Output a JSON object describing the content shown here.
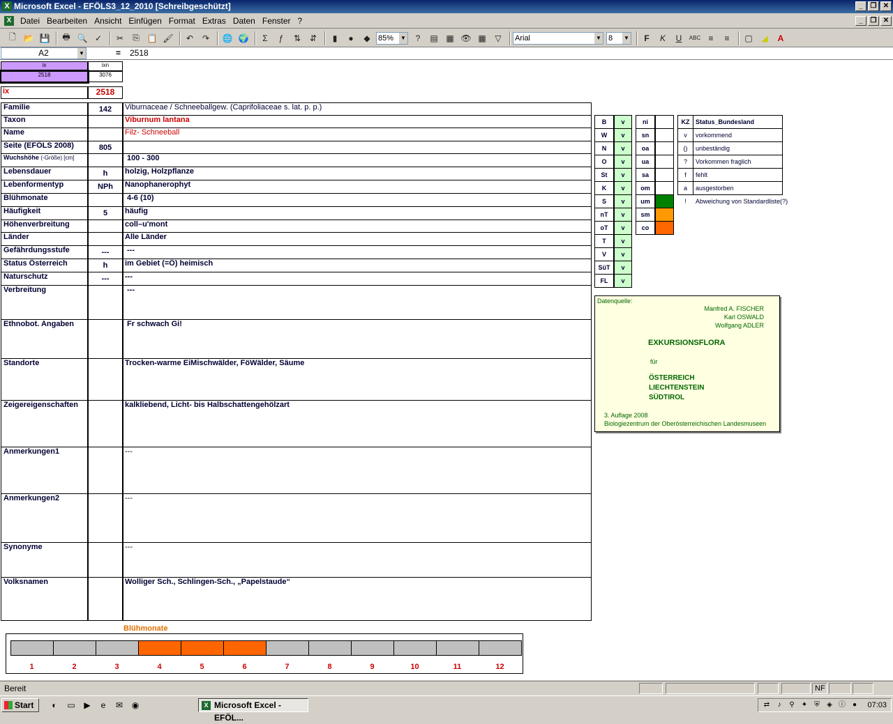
{
  "window": {
    "title": "Microsoft Excel - EFÖLS3_12_2010  [Schreibgeschützt]"
  },
  "menu": [
    "Datei",
    "Bearbeiten",
    "Ansicht",
    "Einfügen",
    "Format",
    "Extras",
    "Daten",
    "Fenster",
    "?"
  ],
  "toolbar": {
    "zoom": "85%",
    "font": "Arial",
    "size": "8"
  },
  "formula": {
    "cell": "A2",
    "fx": "=",
    "value": "2518"
  },
  "sheet": {
    "top_labels": {
      "ix": "ix",
      "ixn": "ixn"
    },
    "top_values": {
      "ix": "2518",
      "ixn": "3076"
    },
    "ix_label": "ix",
    "ix_value": "2518",
    "rows": [
      {
        "label": "Familie",
        "mid": "142",
        "value": "Viburnaceae  /  Schneeballgew. (Caprifoliaceae s. lat. p. p.)"
      },
      {
        "label": "Taxon",
        "mid": "",
        "value": "Viburnum lantana"
      },
      {
        "label": "Name",
        "mid": "",
        "value": "Filz- Schneeball"
      },
      {
        "label": "Seite (EFÖLS 2008)",
        "mid": "805",
        "value": ""
      },
      {
        "label": "Wuchshöhe",
        "label_small": "(-Größe) [cm]",
        "mid": "",
        "value": "100 - 300"
      },
      {
        "label": "Lebensdauer",
        "mid": "h",
        "value": "holzig, Holzpflanze"
      },
      {
        "label": "Lebenformentyp",
        "mid": "NPh",
        "value": "Nanophanerophyt"
      },
      {
        "label": "Blühmonate",
        "mid": "",
        "value": "4-6 (10)"
      },
      {
        "label": "Häufigkeit",
        "mid": "5",
        "value": "häufig"
      },
      {
        "label": "Höhenverbreitung",
        "mid": "",
        "value": "coll–u'mont"
      },
      {
        "label": "Länder",
        "mid": "",
        "value": "Alle Länder"
      },
      {
        "label": "Gefährdungsstufe",
        "mid": "---",
        "value": "---"
      },
      {
        "label": "Status Österreich",
        "mid": "h",
        "value": "im Gebiet (=Ö) heimisch"
      },
      {
        "label": "Naturschutz",
        "mid": "---",
        "value": "---"
      },
      {
        "label": "Verbreitung",
        "mid": "",
        "value": "---"
      },
      {
        "label": "Ethnobot. Angaben",
        "mid": "",
        "value": "Fr schwach Gi!"
      },
      {
        "label": "Standorte",
        "mid": "",
        "value": "Trocken-warme EiMischwälder, FöWälder, Säume"
      },
      {
        "label": "Zeigereigenschaften",
        "mid": "",
        "value": "kalkliebend, Licht- bis Halbschattengehölzart"
      },
      {
        "label": "Anmerkungen1",
        "mid": "",
        "value": "---"
      },
      {
        "label": "Anmerkungen2",
        "mid": "",
        "value": "---"
      },
      {
        "label": "Synonyme",
        "mid": "",
        "value": "---"
      },
      {
        "label": "Volksnamen",
        "mid": "",
        "value": "Wolliger Sch., Schlingen-Sch., „Papelstaude“"
      }
    ],
    "states": [
      {
        "code": "B",
        "v": "v"
      },
      {
        "code": "W",
        "v": "v"
      },
      {
        "code": "N",
        "v": "v"
      },
      {
        "code": "O",
        "v": "v"
      },
      {
        "code": "St",
        "v": "v"
      },
      {
        "code": "K",
        "v": "v"
      },
      {
        "code": "S",
        "v": "v"
      },
      {
        "code": "nT",
        "v": "v"
      },
      {
        "code": "oT",
        "v": "v"
      },
      {
        "code": "T",
        "v": "v"
      },
      {
        "code": "V",
        "v": "v"
      },
      {
        "code": "SüT",
        "v": "v"
      },
      {
        "code": "FL",
        "v": "v"
      }
    ],
    "heights": [
      {
        "code": "ni",
        "color": ""
      },
      {
        "code": "sn",
        "color": ""
      },
      {
        "code": "oa",
        "color": ""
      },
      {
        "code": "ua",
        "color": ""
      },
      {
        "code": "sa",
        "color": ""
      },
      {
        "code": "om",
        "color": ""
      },
      {
        "code": "um",
        "color": "#008000"
      },
      {
        "code": "sm",
        "color": "#ff9900"
      },
      {
        "code": "co",
        "color": "#ff6600"
      }
    ],
    "status_legend": {
      "header_code": "KZ",
      "header_text": "Status_Bundesland",
      "items": [
        {
          "code": "v",
          "text": "vorkommend"
        },
        {
          "code": "()",
          "text": "unbeständig"
        },
        {
          "code": "?",
          "text": "Vorkommen fraglich"
        },
        {
          "code": "f",
          "text": "fehlt"
        },
        {
          "code": "a",
          "text": "ausgestorben"
        },
        {
          "code": "!",
          "text": "Abweichung von Standardliste(?)"
        }
      ]
    },
    "source": {
      "label": "Datenquelle:",
      "authors": [
        "Manfred A. FISCHER",
        "Karl OSWALD",
        "Wolfgang ADLER"
      ],
      "title": "EXKURSIONSFLORA",
      "fuer": "für",
      "regions": [
        "ÖSTERREICH",
        "LIECHTENSTEIN",
        "SÜDTIROL"
      ],
      "edition": "3. Auflage 2008",
      "publisher": "Biologiezentrum der Oberösterreichischen Landesmuseen"
    },
    "bloom": {
      "title": "Blühmonate",
      "months": [
        "1",
        "2",
        "3",
        "4",
        "5",
        "6",
        "7",
        "8",
        "9",
        "10",
        "11",
        "12"
      ],
      "active": [
        false,
        false,
        false,
        true,
        true,
        true,
        false,
        false,
        false,
        false,
        false,
        false
      ]
    }
  },
  "status": {
    "text": "Bereit",
    "nf": "NF"
  },
  "taskbar": {
    "start": "Start",
    "item": "Microsoft Excel - EFÖL...",
    "clock": "07:03"
  }
}
